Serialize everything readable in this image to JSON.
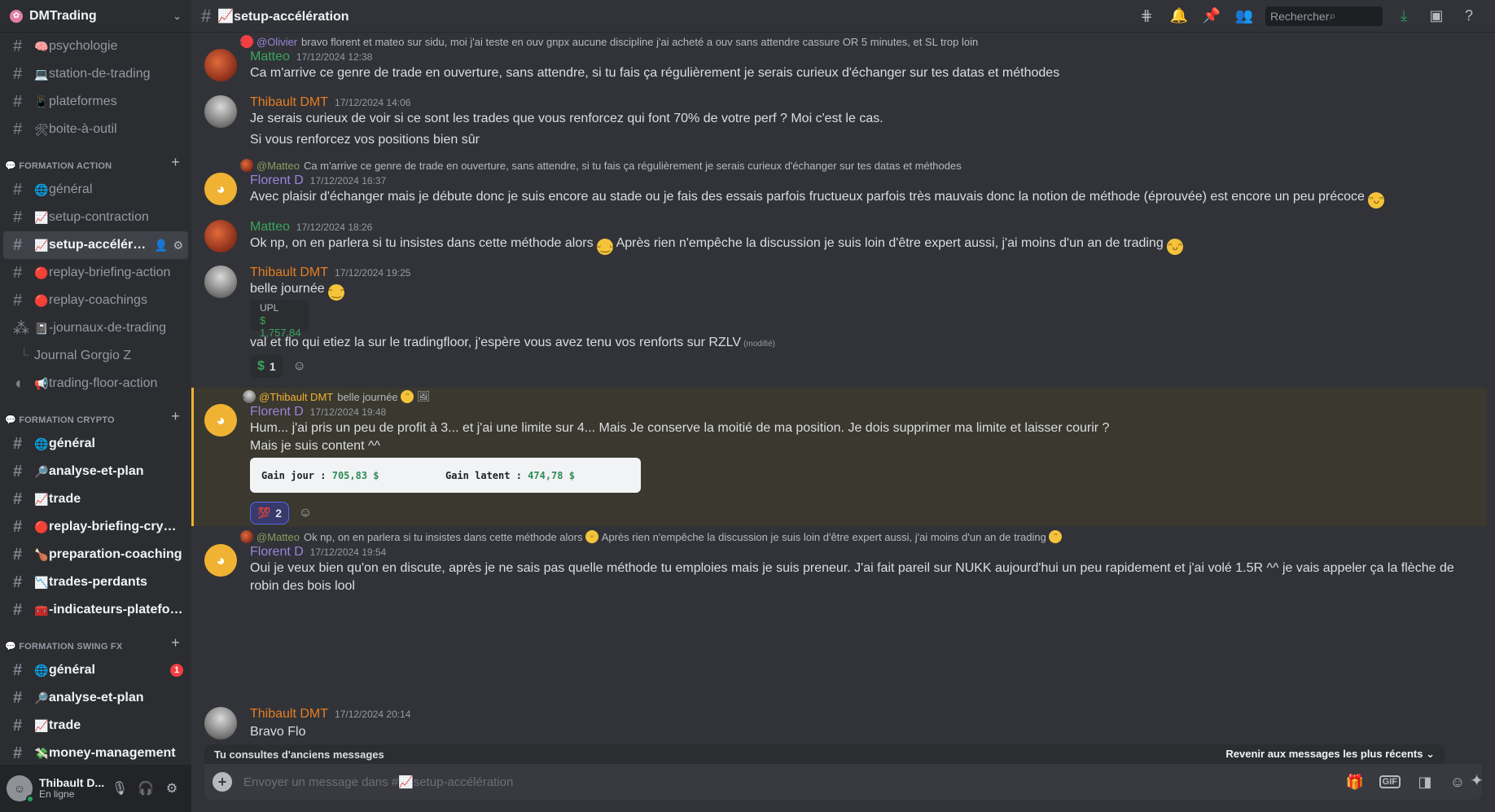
{
  "server": {
    "name": "DMTrading"
  },
  "sidebar": {
    "top_channels": [
      {
        "emoji": "🧠",
        "label": "psychologie"
      },
      {
        "emoji": "💻",
        "label": "station-de-trading"
      },
      {
        "emoji": "📱",
        "label": "plateformes"
      },
      {
        "emoji": "🛠",
        "label": "boite-à-outil"
      }
    ],
    "cat1": {
      "label": "💬 FORMATION ACTION"
    },
    "cat1_channels": [
      {
        "emoji": "🌐",
        "label": "général"
      },
      {
        "emoji": "📈",
        "label": "setup-contraction"
      },
      {
        "emoji": "📈",
        "label": "setup-accéléra..."
      },
      {
        "emoji": "🔴",
        "label": "replay-briefing-action"
      },
      {
        "emoji": "🔴",
        "label": "replay-coachings"
      },
      {
        "emoji": "📓",
        "label": "-journaux-de-trading"
      },
      {
        "emoji": "",
        "label": "Journal Gorgio Z"
      },
      {
        "emoji": "📢",
        "label": "trading-floor-action"
      }
    ],
    "cat2": {
      "label": "💬 FORMATION CRYPTO"
    },
    "cat2_channels": [
      {
        "emoji": "🌐",
        "label": "général"
      },
      {
        "emoji": "🔎",
        "label": "analyse-et-plan"
      },
      {
        "emoji": "📈",
        "label": "trade"
      },
      {
        "emoji": "🔴",
        "label": "replay-briefing-crypto"
      },
      {
        "emoji": "🍗",
        "label": "preparation-coaching"
      },
      {
        "emoji": "📉",
        "label": "trades-perdants"
      },
      {
        "emoji": "🧰",
        "label": "-indicateurs-platefor..."
      }
    ],
    "cat3": {
      "label": "💬 FORMATION SWING FX"
    },
    "cat3_channels": [
      {
        "emoji": "🌐",
        "label": "général",
        "badge": "1"
      },
      {
        "emoji": "🔎",
        "label": "analyse-et-plan"
      },
      {
        "emoji": "📈",
        "label": "trade"
      },
      {
        "emoji": "💸",
        "label": "money-management"
      }
    ],
    "user": {
      "name": "Thibault D...",
      "status": "En ligne"
    }
  },
  "topbar": {
    "channel": "📈setup-accélération",
    "search_placeholder": "Rechercher"
  },
  "messages": {
    "m0": {
      "reply_name": "@Olivier",
      "reply_text": "bravo florent et mateo sur sidu, moi j'ai teste en ouv gnpx aucune discipline j'ai acheté a ouv sans attendre cassure OR 5 minutes, et SL trop loin",
      "author": "Matteo",
      "time": "17/12/2024 12:38",
      "text": "Ca m'arrive ce genre de trade en ouverture, sans attendre, si tu fais ça régulièrement je serais curieux d'échanger sur tes datas et méthodes"
    },
    "m1": {
      "author": "Thibault DMT",
      "time": "17/12/2024 14:06",
      "text1": "Je serais curieux de voir si ce sont les trades que vous renforcez qui font 70% de votre perf ? Moi c'est le cas.",
      "text2": "Si vous renforcez vos positions bien sûr"
    },
    "m2": {
      "reply_name": "@Matteo",
      "reply_text": "Ca m'arrive ce genre de trade en ouverture, sans attendre, si tu fais ça régulièrement je serais curieux d'échanger sur tes datas et méthodes",
      "author": "Florent D",
      "time": "17/12/2024 16:37",
      "text": "Avec plaisir d'échanger mais je débute donc je suis encore au stade ou je fais des essais parfois fructueux parfois très mauvais donc la notion de méthode (éprouvée) est encore un peu précoce"
    },
    "m3": {
      "author": "Matteo",
      "time": "17/12/2024 18:26",
      "text_a": "Ok np, on en parlera si tu insistes dans cette méthode alors",
      "text_b": "Après rien n'empêche la discussion je suis loin d'être expert aussi, j'ai moins d'un an de trading"
    },
    "m4": {
      "author": "Thibault DMT",
      "time": "17/12/2024 19:25",
      "text1": "belle journée",
      "embed_key": "UPL",
      "embed_val": "$ 1,757.84",
      "text2": "val et flo qui etiez la sur le tradingfloor, j'espère vous avez tenu vos renforts sur RZLV",
      "edited": "(modifié)",
      "react_count": "1"
    },
    "m5": {
      "reply_name": "@Thibault DMT",
      "reply_text": "belle journée",
      "author": "Florent D",
      "time": "17/12/2024 19:48",
      "text1": "Hum... j'ai pris un peu de profit à 3... et j'ai  une limite sur 4... Mais Je conserve la moitié de ma position. Je dois supprimer ma limite et laisser courir ?",
      "text2": "Mais je suis content ^^",
      "gain1_label": "Gain jour :",
      "gain1_val": "705,83 $",
      "gain2_label": "Gain latent :",
      "gain2_val": "474,78 $",
      "react_count": "2"
    },
    "m6": {
      "reply_name": "@Matteo",
      "reply_text_a": "Ok np, on en parlera si tu insistes dans cette méthode alors",
      "reply_text_b": "Après rien n'empêche la discussion je suis loin d'être expert aussi, j'ai moins d'un an de trading",
      "author": "Florent D",
      "time": "17/12/2024 19:54",
      "text": "Oui je veux bien qu'on en discute, après je ne sais pas quelle méthode tu emploies mais je suis preneur. J'ai fait pareil sur NUKK aujourd'hui un peu rapidement et j'ai volé 1.5R ^^ je vais appeler ça la flèche de robin des bois lool"
    },
    "m7": {
      "author": "Thibault DMT",
      "time": "17/12/2024 20:14",
      "text": "Bravo Flo"
    }
  },
  "banner": {
    "left": "Tu consultes d'anciens messages",
    "right": "Revenir aux messages les plus récents"
  },
  "composer": {
    "placeholder": "Envoyer un message dans #📈setup-accélération"
  },
  "colors": {
    "accent": "#5865f2",
    "online": "#23a55a",
    "highlight": "#f0b232"
  }
}
